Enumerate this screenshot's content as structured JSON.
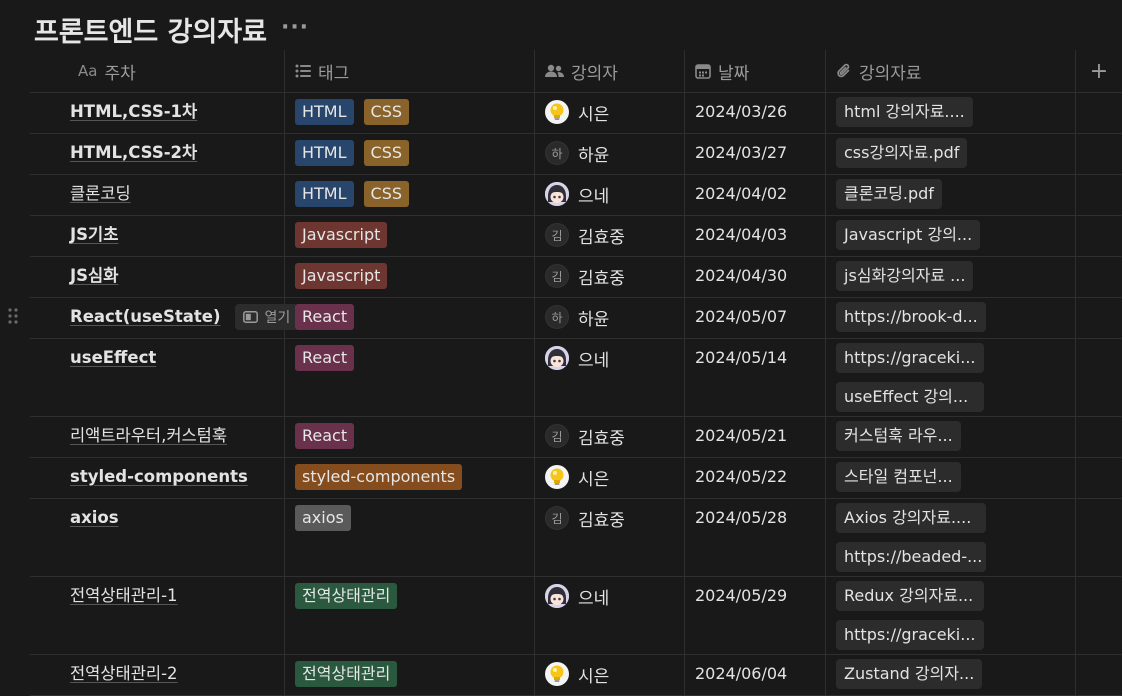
{
  "page": {
    "title": "프론트엔드 강의자료",
    "more": "···"
  },
  "columns": [
    {
      "label": "주차",
      "prefix": "Aa",
      "icon": "title-icon"
    },
    {
      "label": "태그",
      "icon": "list-icon"
    },
    {
      "label": "강의자",
      "icon": "people-icon"
    },
    {
      "label": "날짜",
      "icon": "calendar-icon"
    },
    {
      "label": "강의자료",
      "icon": "paperclip-icon"
    }
  ],
  "add_column": "+",
  "open_label": "열기",
  "tag_colors": {
    "HTML": "#28456c",
    "CSS": "#89632a",
    "Javascript": "#6e3630",
    "React": "#69314c",
    "styled-components": "#854c1d",
    "axios": "#5a5a5a",
    "전역상태관리": "#2b593f"
  },
  "rows": [
    {
      "name": "HTML,CSS-1차",
      "bold": true,
      "tags": [
        "HTML",
        "CSS"
      ],
      "person": "시은",
      "avatar": "bulb",
      "date": "2024/03/26",
      "files": [
        "html 강의자료...."
      ]
    },
    {
      "name": "HTML,CSS-2차",
      "bold": true,
      "tags": [
        "HTML",
        "CSS"
      ],
      "person": "하윤",
      "avatar": "init",
      "initial": "하",
      "date": "2024/03/27",
      "files": [
        "css강의자료.pdf"
      ]
    },
    {
      "name": "클론코딩",
      "bold": false,
      "tags": [
        "HTML",
        "CSS"
      ],
      "person": "으네",
      "avatar": "anime",
      "date": "2024/04/02",
      "files": [
        "클론코딩.pdf"
      ]
    },
    {
      "name": "JS기초",
      "bold": true,
      "tags": [
        "Javascript"
      ],
      "person": "김효중",
      "avatar": "init",
      "initial": "김",
      "date": "2024/04/03",
      "files": [
        "Javascript 강의..."
      ]
    },
    {
      "name": "JS심화",
      "bold": true,
      "tags": [
        "Javascript"
      ],
      "person": "김효중",
      "avatar": "init",
      "initial": "김",
      "date": "2024/04/30",
      "files": [
        "js심화강의자료 ..."
      ]
    },
    {
      "name": "React(useState)",
      "bold": true,
      "hover": true,
      "tags": [
        "React"
      ],
      "person": "하윤",
      "avatar": "init",
      "initial": "하",
      "date": "2024/05/07",
      "files": [
        "https://brook-d..."
      ]
    },
    {
      "name": "useEffect",
      "bold": true,
      "tags": [
        "React"
      ],
      "person": "으네",
      "avatar": "anime",
      "date": "2024/05/14",
      "files": [
        "https://graceki...",
        "useEffect 강의..."
      ]
    },
    {
      "name": "리액트라우터,커스텀훅",
      "bold": false,
      "tags": [
        "React"
      ],
      "person": "김효중",
      "avatar": "init",
      "initial": "김",
      "date": "2024/05/21",
      "files": [
        "커스텀훅 라우..."
      ]
    },
    {
      "name": "styled-components",
      "bold": true,
      "tags": [
        "styled-components"
      ],
      "person": "시은",
      "avatar": "bulb",
      "date": "2024/05/22",
      "files": [
        "스타일 컴포넌..."
      ]
    },
    {
      "name": "axios",
      "bold": true,
      "tags": [
        "axios"
      ],
      "person": "김효중",
      "avatar": "init",
      "initial": "김",
      "date": "2024/05/28",
      "files": [
        "Axios 강의자료....",
        "https://beaded-..."
      ]
    },
    {
      "name": "전역상태관리-1",
      "bold": false,
      "tags": [
        "전역상태관리"
      ],
      "person": "으네",
      "avatar": "anime",
      "date": "2024/05/29",
      "files": [
        "Redux 강의자료...",
        "https://graceki..."
      ]
    },
    {
      "name": "전역상태관리-2",
      "bold": false,
      "tags": [
        "전역상태관리"
      ],
      "person": "시은",
      "avatar": "bulb",
      "date": "2024/06/04",
      "files": [
        "Zustand 강의자..."
      ]
    }
  ]
}
